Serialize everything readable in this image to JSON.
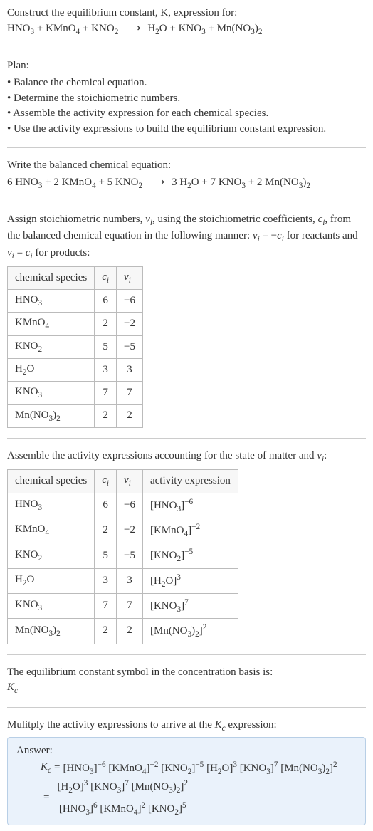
{
  "title_line1": "Construct the equilibrium constant, K, expression for:",
  "title_eq": "HNO₃ + KMnO₄ + KNO₂  ⟶  H₂O + KNO₃ + Mn(NO₃)₂",
  "plan_label": "Plan:",
  "plan_items": [
    "• Balance the chemical equation.",
    "• Determine the stoichiometric numbers.",
    "• Assemble the activity expression for each chemical species.",
    "• Use the activity expressions to build the equilibrium constant expression."
  ],
  "balanced_label": "Write the balanced chemical equation:",
  "balanced_eq": "6 HNO₃ + 2 KMnO₄ + 5 KNO₂  ⟶  3 H₂O + 7 KNO₃ + 2 Mn(NO₃)₂",
  "stoich_intro": "Assign stoichiometric numbers, νᵢ, using the stoichiometric coefficients, cᵢ, from the balanced chemical equation in the following manner: νᵢ = −cᵢ for reactants and νᵢ = cᵢ for products:",
  "table1_headers": [
    "chemical species",
    "cᵢ",
    "νᵢ"
  ],
  "table1_rows": [
    [
      "HNO₃",
      "6",
      "−6"
    ],
    [
      "KMnO₄",
      "2",
      "−2"
    ],
    [
      "KNO₂",
      "5",
      "−5"
    ],
    [
      "H₂O",
      "3",
      "3"
    ],
    [
      "KNO₃",
      "7",
      "7"
    ],
    [
      "Mn(NO₃)₂",
      "2",
      "2"
    ]
  ],
  "activity_intro": "Assemble the activity expressions accounting for the state of matter and νᵢ:",
  "table2_headers": [
    "chemical species",
    "cᵢ",
    "νᵢ",
    "activity expression"
  ],
  "table2_rows": [
    [
      "HNO₃",
      "6",
      "−6",
      "[HNO₃]⁻⁶"
    ],
    [
      "KMnO₄",
      "2",
      "−2",
      "[KMnO₄]⁻²"
    ],
    [
      "KNO₂",
      "5",
      "−5",
      "[KNO₂]⁻⁵"
    ],
    [
      "H₂O",
      "3",
      "3",
      "[H₂O]³"
    ],
    [
      "KNO₃",
      "7",
      "7",
      "[KNO₃]⁷"
    ],
    [
      "Mn(NO₃)₂",
      "2",
      "2",
      "[Mn(NO₃)₂]²"
    ]
  ],
  "kc_symbol_intro": "The equilibrium constant symbol in the concentration basis is:",
  "kc_symbol": "K_c",
  "mult_intro": "Mulitply the activity expressions to arrive at the K_c expression:",
  "answer_label": "Answer:",
  "answer_line1": "K_c = [HNO₃]⁻⁶ [KMnO₄]⁻² [KNO₂]⁻⁵ [H₂O]³ [KNO₃]⁷ [Mn(NO₃)₂]²",
  "answer_num": "[H₂O]³ [KNO₃]⁷ [Mn(NO₃)₂]²",
  "answer_den": "[HNO₃]⁶ [KMnO₄]² [KNO₂]⁵",
  "chart_data": {
    "type": "table",
    "tables": [
      {
        "title": "Stoichiometric numbers",
        "columns": [
          "chemical species",
          "c_i",
          "ν_i"
        ],
        "rows": [
          [
            "HNO3",
            6,
            -6
          ],
          [
            "KMnO4",
            2,
            -2
          ],
          [
            "KNO2",
            5,
            -5
          ],
          [
            "H2O",
            3,
            3
          ],
          [
            "KNO3",
            7,
            7
          ],
          [
            "Mn(NO3)2",
            2,
            2
          ]
        ]
      },
      {
        "title": "Activity expressions",
        "columns": [
          "chemical species",
          "c_i",
          "ν_i",
          "activity expression"
        ],
        "rows": [
          [
            "HNO3",
            6,
            -6,
            "[HNO3]^-6"
          ],
          [
            "KMnO4",
            2,
            -2,
            "[KMnO4]^-2"
          ],
          [
            "KNO2",
            5,
            -5,
            "[KNO2]^-5"
          ],
          [
            "H2O",
            3,
            3,
            "[H2O]^3"
          ],
          [
            "KNO3",
            7,
            7,
            "[KNO3]^7"
          ],
          [
            "Mn(NO3)2",
            2,
            2,
            "[Mn(NO3)2]^2"
          ]
        ]
      }
    ]
  }
}
